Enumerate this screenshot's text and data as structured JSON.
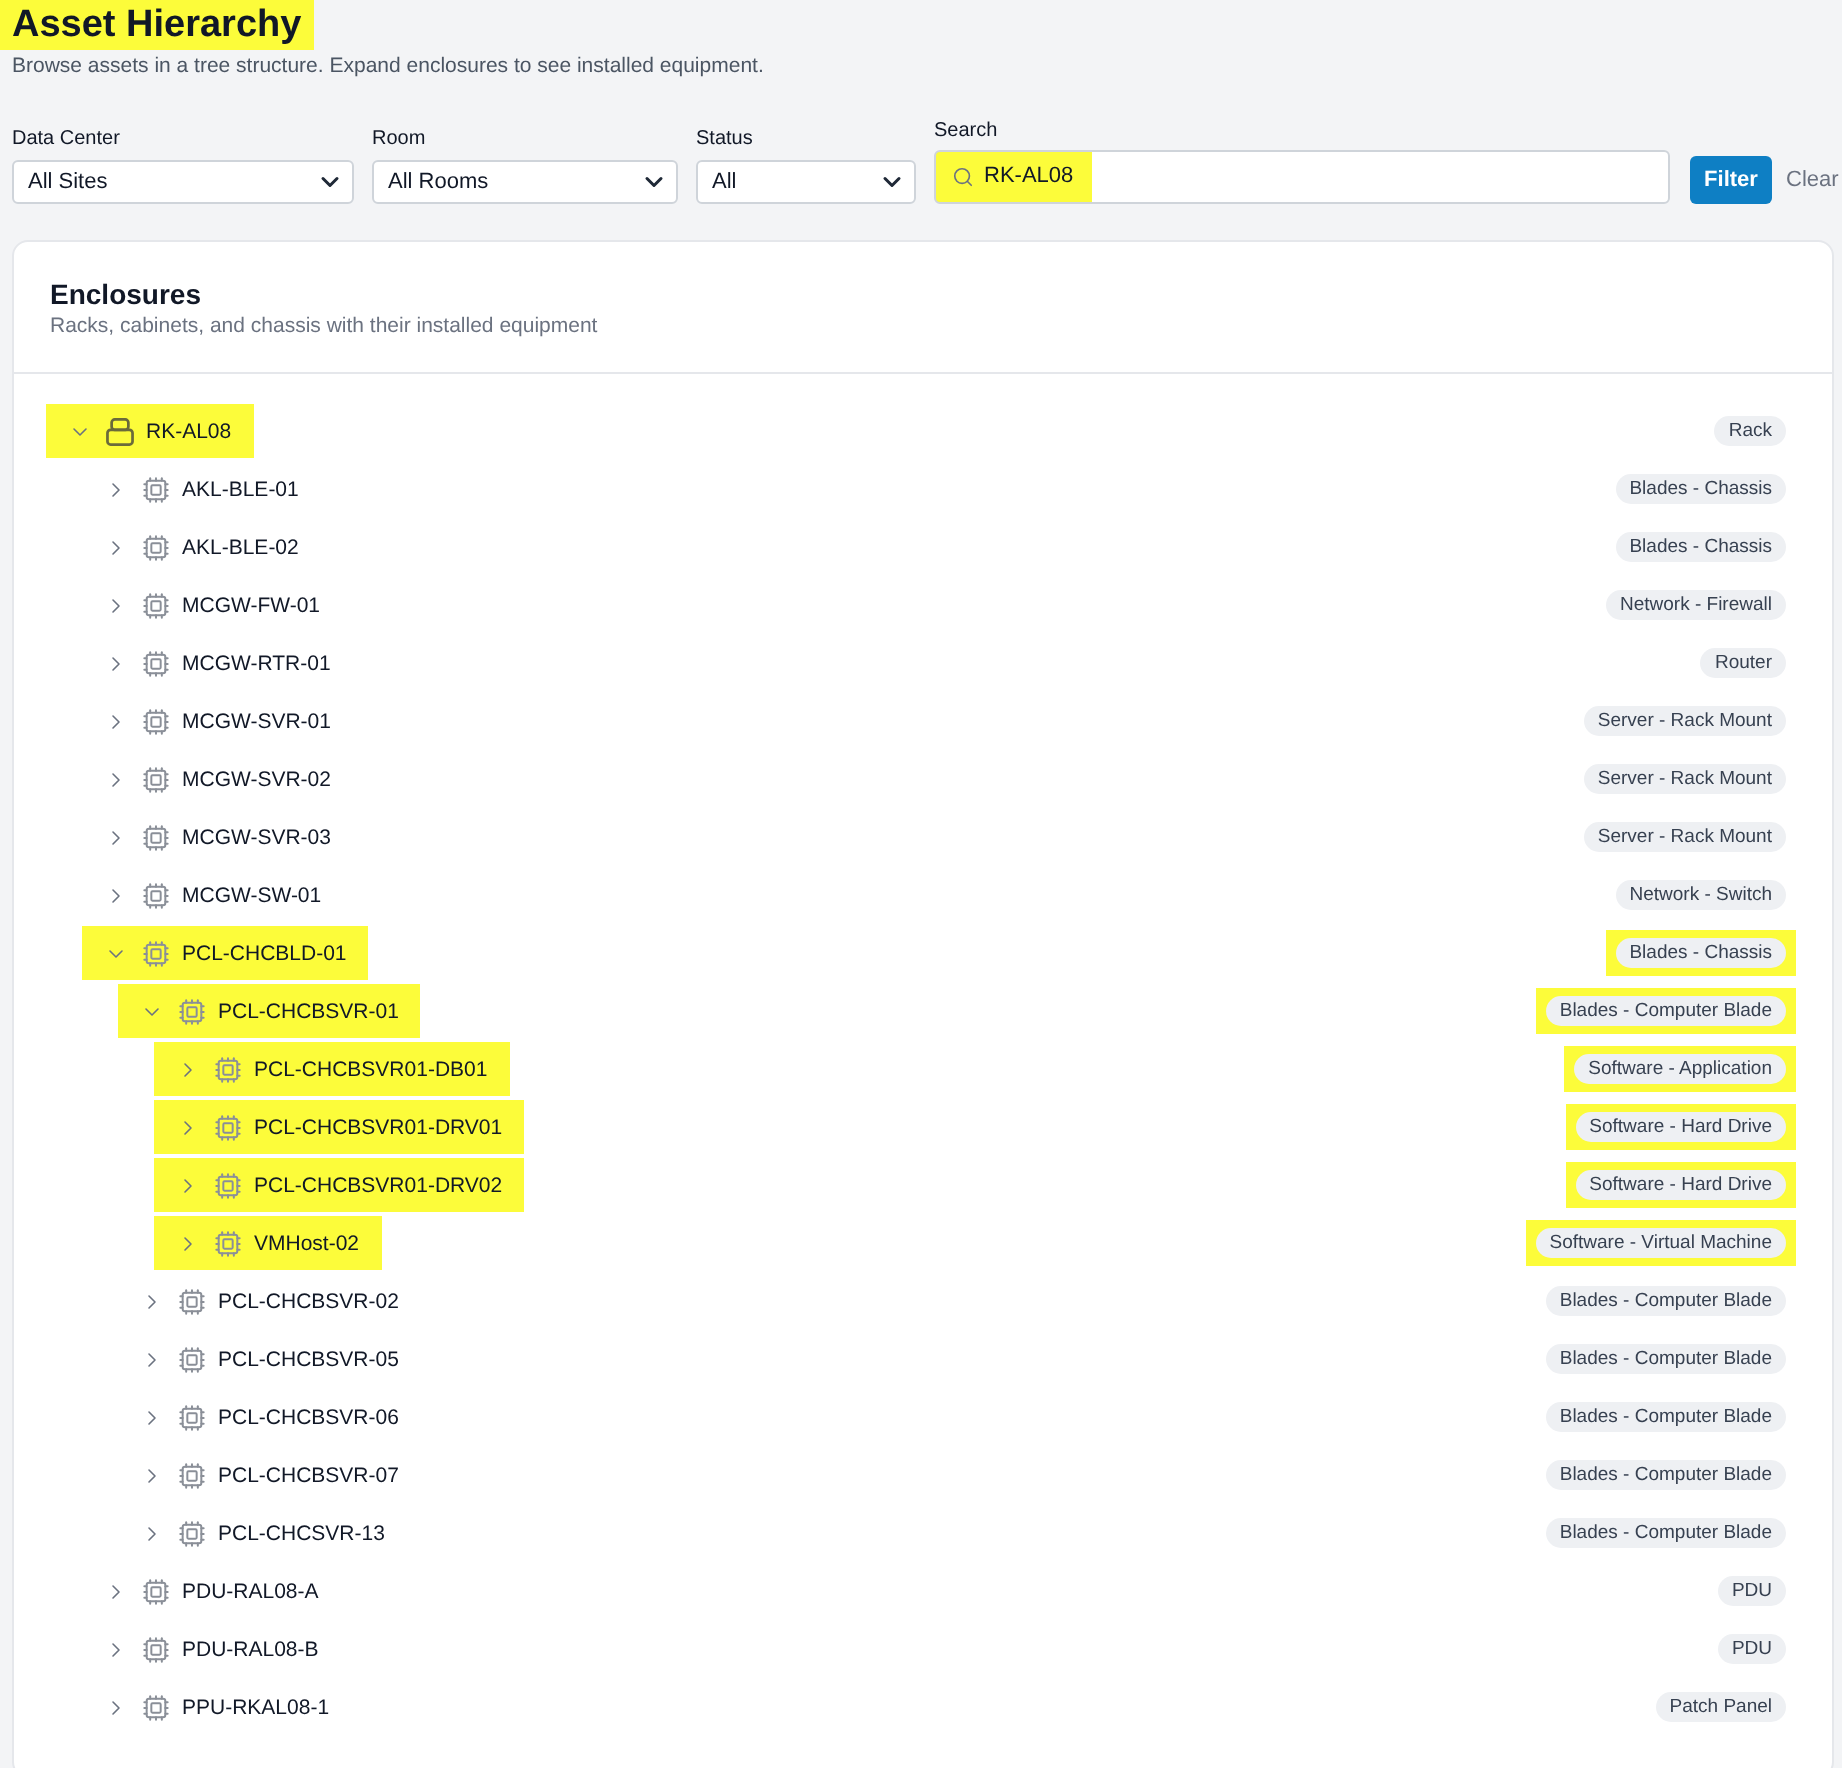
{
  "title": {
    "text": "Asset Hierarchy",
    "highlighted": true
  },
  "subtitle": "Browse assets in a tree structure. Expand enclosures to see installed equipment.",
  "filters": [
    {
      "label": "Data Center",
      "value": "All Sites"
    },
    {
      "label": "Room",
      "value": "All Rooms"
    },
    {
      "label": "Status",
      "value": "All"
    }
  ],
  "search": {
    "label": "Search",
    "value": "RK-AL08",
    "highlighted": true
  },
  "buttons": {
    "filter": "Filter",
    "clear": "Clear"
  },
  "panel": {
    "title": "Enclosures",
    "subtitle": "Racks, cabinets, and chassis with their installed equipment"
  },
  "tree": [
    {
      "name": "RK-AL08",
      "type": "Rack",
      "kind": "rack",
      "expanded": true,
      "highlighted": true,
      "type_highlighted": false,
      "children": [
        {
          "name": "AKL-BLE-01",
          "type": "Blades - Chassis",
          "kind": "device",
          "expanded": false,
          "highlighted": false,
          "type_highlighted": false
        },
        {
          "name": "AKL-BLE-02",
          "type": "Blades - Chassis",
          "kind": "device",
          "expanded": false,
          "highlighted": false,
          "type_highlighted": false
        },
        {
          "name": "MCGW-FW-01",
          "type": "Network - Firewall",
          "kind": "device",
          "expanded": false,
          "highlighted": false,
          "type_highlighted": false
        },
        {
          "name": "MCGW-RTR-01",
          "type": "Router",
          "kind": "device",
          "expanded": false,
          "highlighted": false,
          "type_highlighted": false
        },
        {
          "name": "MCGW-SVR-01",
          "type": "Server - Rack Mount",
          "kind": "device",
          "expanded": false,
          "highlighted": false,
          "type_highlighted": false
        },
        {
          "name": "MCGW-SVR-02",
          "type": "Server - Rack Mount",
          "kind": "device",
          "expanded": false,
          "highlighted": false,
          "type_highlighted": false
        },
        {
          "name": "MCGW-SVR-03",
          "type": "Server - Rack Mount",
          "kind": "device",
          "expanded": false,
          "highlighted": false,
          "type_highlighted": false
        },
        {
          "name": "MCGW-SW-01",
          "type": "Network - Switch",
          "kind": "device",
          "expanded": false,
          "highlighted": false,
          "type_highlighted": false
        },
        {
          "name": "PCL-CHCBLD-01",
          "type": "Blades - Chassis",
          "kind": "device",
          "expanded": true,
          "highlighted": true,
          "type_highlighted": true,
          "children": [
            {
              "name": "PCL-CHCBSVR-01",
              "type": "Blades - Computer Blade",
              "kind": "device",
              "expanded": true,
              "highlighted": true,
              "type_highlighted": true,
              "children": [
                {
                  "name": "PCL-CHCBSVR01-DB01",
                  "type": "Software - Application",
                  "kind": "device",
                  "expanded": false,
                  "highlighted": true,
                  "type_highlighted": true
                },
                {
                  "name": "PCL-CHCBSVR01-DRV01",
                  "type": "Software - Hard Drive",
                  "kind": "device",
                  "expanded": false,
                  "highlighted": true,
                  "type_highlighted": true
                },
                {
                  "name": "PCL-CHCBSVR01-DRV02",
                  "type": "Software - Hard Drive",
                  "kind": "device",
                  "expanded": false,
                  "highlighted": true,
                  "type_highlighted": true
                },
                {
                  "name": "VMHost-02",
                  "type": "Software - Virtual Machine",
                  "kind": "device",
                  "expanded": false,
                  "highlighted": true,
                  "type_highlighted": true
                }
              ]
            },
            {
              "name": "PCL-CHCBSVR-02",
              "type": "Blades - Computer Blade",
              "kind": "device",
              "expanded": false,
              "highlighted": false,
              "type_highlighted": false
            },
            {
              "name": "PCL-CHCBSVR-05",
              "type": "Blades - Computer Blade",
              "kind": "device",
              "expanded": false,
              "highlighted": false,
              "type_highlighted": false
            },
            {
              "name": "PCL-CHCBSVR-06",
              "type": "Blades - Computer Blade",
              "kind": "device",
              "expanded": false,
              "highlighted": false,
              "type_highlighted": false
            },
            {
              "name": "PCL-CHCBSVR-07",
              "type": "Blades - Computer Blade",
              "kind": "device",
              "expanded": false,
              "highlighted": false,
              "type_highlighted": false
            },
            {
              "name": "PCL-CHCSVR-13",
              "type": "Blades - Computer Blade",
              "kind": "device",
              "expanded": false,
              "highlighted": false,
              "type_highlighted": false
            }
          ]
        },
        {
          "name": "PDU-RAL08-A",
          "type": "PDU",
          "kind": "device",
          "expanded": false,
          "highlighted": false,
          "type_highlighted": false
        },
        {
          "name": "PDU-RAL08-B",
          "type": "PDU",
          "kind": "device",
          "expanded": false,
          "highlighted": false,
          "type_highlighted": false
        },
        {
          "name": "PPU-RKAL08-1",
          "type": "Patch Panel",
          "kind": "device",
          "expanded": false,
          "highlighted": false,
          "type_highlighted": false
        }
      ]
    }
  ]
}
